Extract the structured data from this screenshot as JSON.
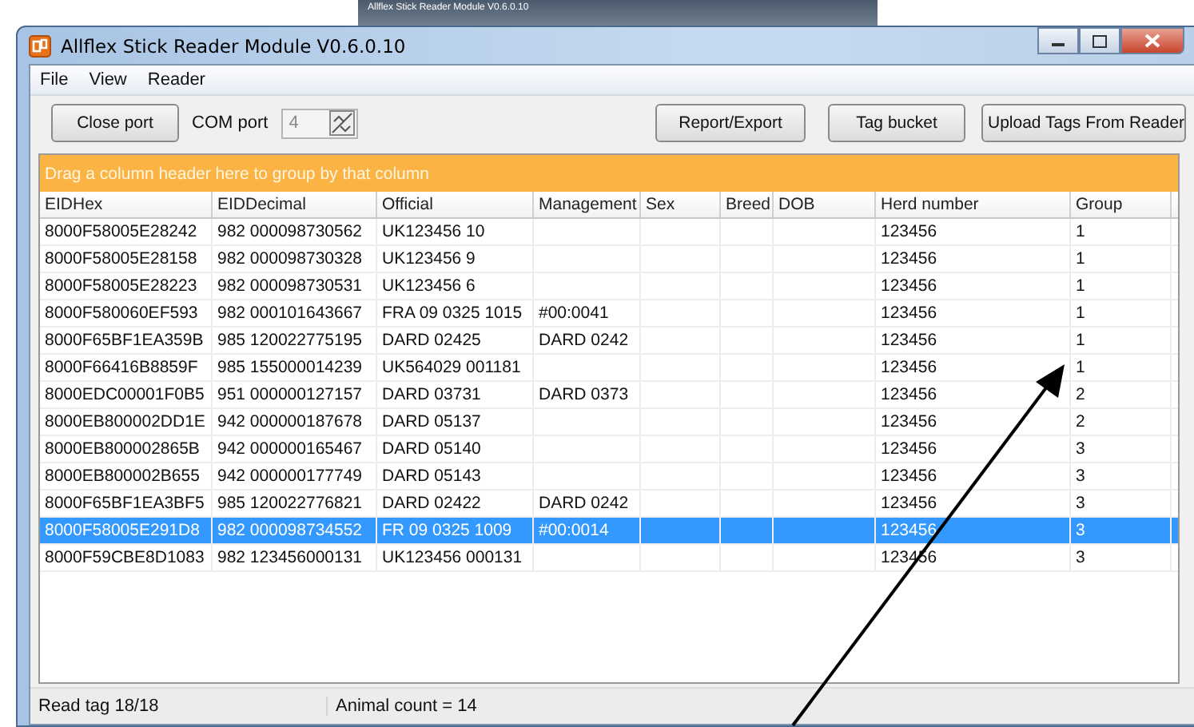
{
  "preview_window": {
    "title": "Allflex Stick Reader Module V0.6.0.10"
  },
  "window": {
    "title": "Allflex Stick Reader Module V0.6.0.10"
  },
  "menu": [
    "File",
    "View",
    "Reader"
  ],
  "toolbar": {
    "close_port": "Close port",
    "com_port_label": "COM port",
    "com_port_value": "4",
    "buttons": [
      "Report/Export",
      "Tag bucket",
      "Upload Tags From Reader"
    ]
  },
  "group_panel": {
    "hint": "Drag a column header here to group by that column"
  },
  "table": {
    "columns": [
      "EIDHex",
      "EIDDecimal",
      "Official",
      "Management",
      "Sex",
      "Breed",
      "DOB",
      "Herd number",
      "Group"
    ],
    "rows": [
      {
        "cells": [
          "8000F58005E28242",
          "982 000098730562",
          "UK123456 10",
          "",
          "",
          "",
          "",
          "123456",
          "1"
        ],
        "selected": false
      },
      {
        "cells": [
          "8000F58005E28158",
          "982 000098730328",
          "UK123456 9",
          "",
          "",
          "",
          "",
          "123456",
          "1"
        ],
        "selected": false
      },
      {
        "cells": [
          "8000F58005E28223",
          "982 000098730531",
          "UK123456 6",
          "",
          "",
          "",
          "",
          "123456",
          "1"
        ],
        "selected": false
      },
      {
        "cells": [
          "8000F580060EF593",
          "982 000101643667",
          "FRA 09 0325 1015",
          "#00:0041",
          "",
          "",
          "",
          "123456",
          "1"
        ],
        "selected": false
      },
      {
        "cells": [
          "8000F65BF1EA359B",
          "985 120022775195",
          "DARD 02425",
          "DARD 0242",
          "",
          "",
          "",
          "123456",
          "1"
        ],
        "selected": false
      },
      {
        "cells": [
          "8000F66416B8859F",
          "985 155000014239",
          "UK564029 001181",
          "",
          "",
          "",
          "",
          "123456",
          "1"
        ],
        "selected": false
      },
      {
        "cells": [
          "8000EDC00001F0B5",
          "951 000000127157",
          "DARD 03731",
          "DARD 0373",
          "",
          "",
          "",
          "123456",
          "2"
        ],
        "selected": false
      },
      {
        "cells": [
          "8000EB800002DD1E",
          "942 000000187678",
          "DARD 05137",
          "",
          "",
          "",
          "",
          "123456",
          "2"
        ],
        "selected": false
      },
      {
        "cells": [
          "8000EB800002865B",
          "942 000000165467",
          "DARD 05140",
          "",
          "",
          "",
          "",
          "123456",
          "3"
        ],
        "selected": false
      },
      {
        "cells": [
          "8000EB800002B655",
          "942 000000177749",
          "DARD 05143",
          "",
          "",
          "",
          "",
          "123456",
          "3"
        ],
        "selected": false
      },
      {
        "cells": [
          "8000F65BF1EA3BF5",
          "985 120022776821",
          "DARD 02422",
          "DARD 0242",
          "",
          "",
          "",
          "123456",
          "3"
        ],
        "selected": false
      },
      {
        "cells": [
          "8000F58005E291D8",
          "982 000098734552",
          "FR 09 0325 1009",
          "#00:0014",
          "",
          "",
          "",
          "123456",
          "3"
        ],
        "selected": true
      },
      {
        "cells": [
          "8000F59CBE8D1083",
          "982 123456000131",
          "UK123456 000131",
          "",
          "",
          "",
          "",
          "123456",
          "3"
        ],
        "selected": false
      }
    ]
  },
  "status_bar": [
    "Read tag 18/18",
    "Animal count = 14"
  ]
}
